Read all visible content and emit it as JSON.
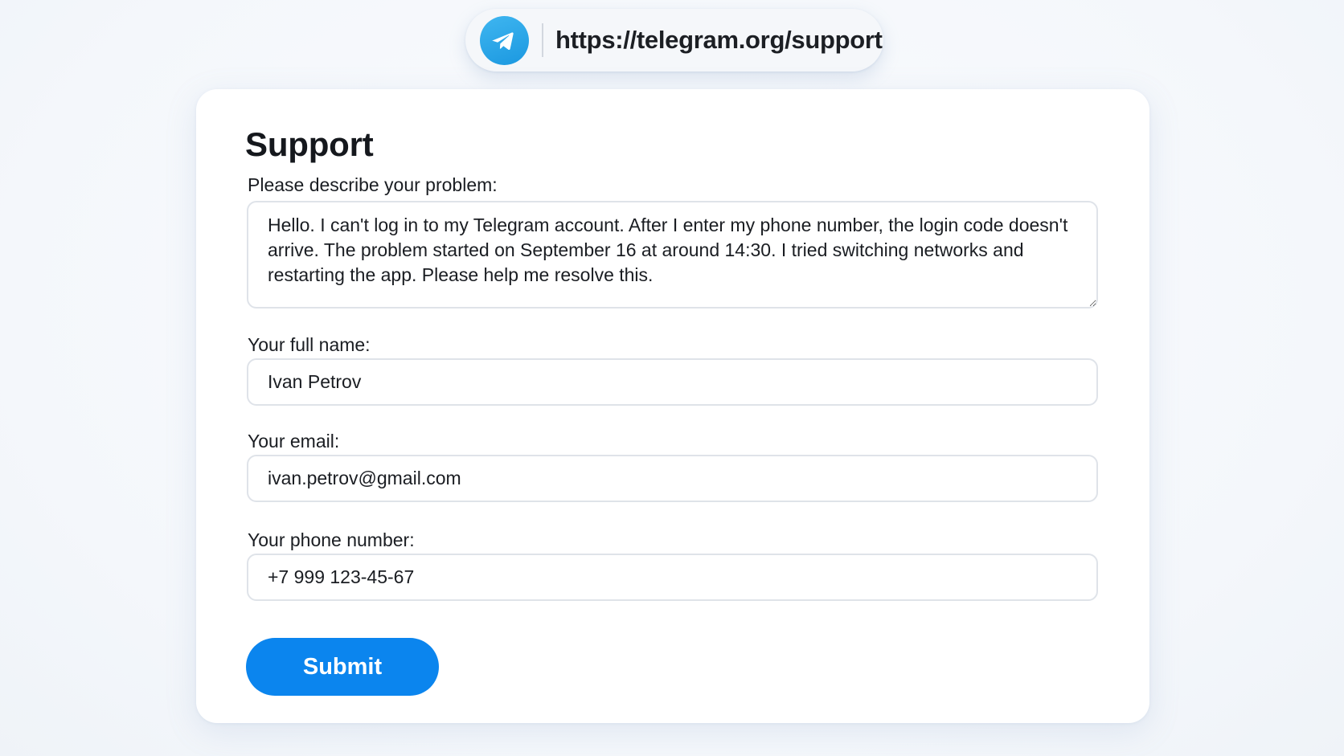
{
  "address_bar": {
    "url": "https://telegram.org/support",
    "logo_icon": "telegram-paper-plane-icon",
    "logo_color": "#229ED9"
  },
  "form": {
    "title": "Support",
    "problem": {
      "label": "Please describe your problem:",
      "value": "Hello. I can't log in to my Telegram account. After I enter my phone number, the login code doesn't arrive. The problem started on September 16 at around 14:30. I tried switching networks and restarting the app. Please help me resolve this."
    },
    "full_name": {
      "label": "Your full name:",
      "value": "Ivan Petrov"
    },
    "email": {
      "label": "Your email:",
      "value": "ivan.petrov@gmail.com"
    },
    "phone": {
      "label": "Your phone number:",
      "value": "+7 999 123-45-67"
    },
    "submit_label": "Submit",
    "accent_color": "#0B85EE"
  }
}
